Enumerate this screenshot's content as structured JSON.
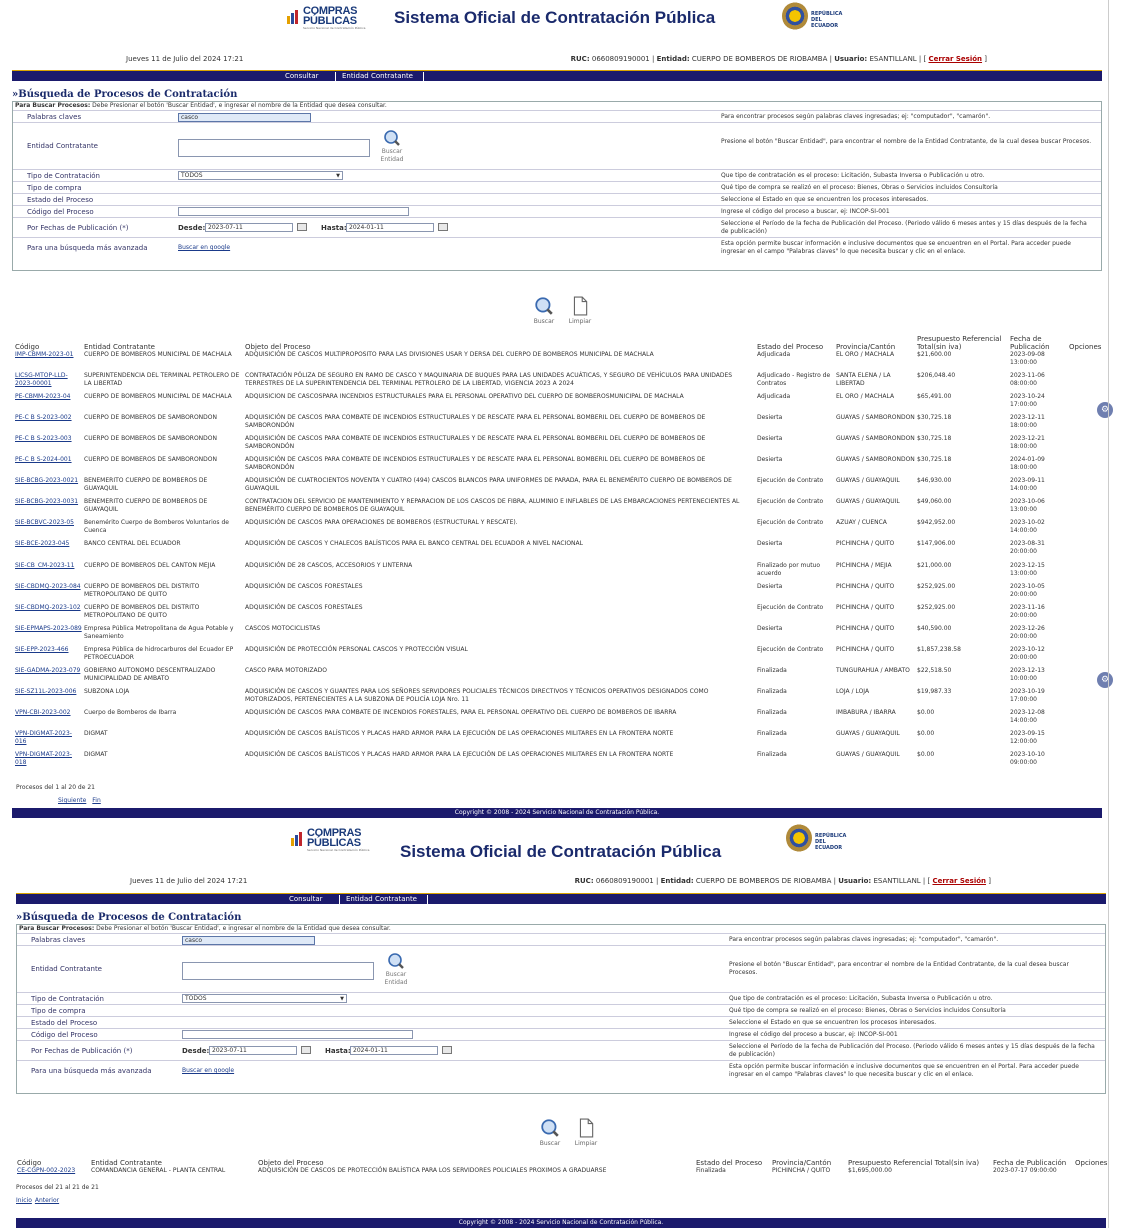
{
  "header": {
    "logo_line1": "COMPRAS",
    "logo_line2": "PÚBLICAS",
    "logo_sub": "Servicio Nacional de Contratación Pública",
    "system_title": "Sistema Oficial de Contratación Pública",
    "republic_line1": "REPÚBLICA",
    "republic_line2": "DEL ECUADOR"
  },
  "userbar": {
    "date": "Jueves 11 de Julio del 2024 17:21",
    "ruc_label": "RUC:",
    "ruc": "0660809190001",
    "entity_label": "Entidad:",
    "entity": "CUERPO DE BOMBEROS DE RIOBAMBA",
    "user_label": "Usuario:",
    "user": "ESANTILLANL",
    "logout": "Cerrar Sesión"
  },
  "nav": {
    "tab1": "Consultar",
    "tab2": "Entidad Contratante"
  },
  "search": {
    "title": "»Búsqueda de Procesos de Contratación",
    "instruction_bold": "Para Buscar Procesos:",
    "instruction": " Debe Presionar el botón 'Buscar Entidad', e ingresar el nombre de la Entidad que desea consultar.",
    "keywords_label": "Palabras claves",
    "keywords_value": "casco",
    "keywords_help": "Para encontrar procesos según palabras claves ingresadas; ej: \"computador\", \"camarón\".",
    "entity_label": "Entidad Contratante",
    "entity_button": "Buscar Entidad",
    "entity_help": "Presione el botón \"Buscar Entidad\", para encontrar el nombre de la Entidad Contratante, de la cual desea buscar Procesos.",
    "type_label": "Tipo de Contratación",
    "type_value": "TODOS",
    "type_help": "Que tipo de contratación es el proceso: Licitación, Subasta Inversa o Publicación u otro.",
    "purchase_label": "Tipo de compra",
    "purchase_help": "Qué tipo de compra se realizó en el proceso: Bienes, Obras o Servicios incluidos Consultoría",
    "state_label": "Estado del Proceso",
    "state_help": "Seleccione el Estado en que se encuentren los procesos interesados.",
    "code_label": "Código del Proceso",
    "code_help": "Ingrese el código del proceso a buscar, ej: INCOP-SI-001",
    "dates_label": "Por Fechas de Publicación (*)",
    "from_label": "Desde:",
    "from_value": "2023-07-11",
    "to_label": "Hasta:",
    "to_value": "2024-01-11",
    "dates_help": "Seleccione el Período de la fecha de Publicación del Proceso. (Periodo válido 6 meses antes y 15 días después de la fecha de publicación)",
    "advanced_label": "Para una búsqueda más avanzada",
    "advanced_link": "Buscar en google",
    "advanced_help": "Esta opción permite buscar información e inclusive documentos que se encuentren en el Portal. Para acceder puede ingresar en el campo \"Palabras claves\" lo que necesita buscar y clic en el enlace.",
    "btn_search": "Buscar",
    "btn_clear": "Limpiar"
  },
  "table": {
    "headers": [
      "Código",
      "Entidad Contratante",
      "Objeto del Proceso",
      "Estado del Proceso",
      "Provincia/Cantón",
      "Presupuesto Referencial Total(sin iva)",
      "Fecha de Publicación",
      "Opciones"
    ]
  },
  "rows1": [
    [
      "IMP-CBMM-2023-01",
      "CUERPO DE BOMBEROS MUNICIPAL DE MACHALA",
      "ADQUISICIÓN DE CASCOS MULTIPROPOSITO PARA LAS DIVISIONES USAR Y DERSA DEL CUERPO DE BOMBEROS MUNICIPAL DE MACHALA",
      "Adjudicada",
      "EL ORO / MACHALA",
      "$21,600.00",
      "2023-09-08 13:00:00"
    ],
    [
      "LICSG-MTOP-LLD-2023-00001",
      "SUPERINTENDENCIA DEL TERMINAL PETROLERO DE LA LIBERTAD",
      "CONTRATACIÓN PÓLIZA DE SEGURO EN RAMO DE CASCO Y MAQUINARIA DE BUQUES PARA LAS UNIDADES ACUÁTICAS, Y SEGURO DE VEHÍCULOS PARA UNIDADES TERRESTRES DE LA SUPERINTENDENCIA DEL TERMINAL PETROLERO DE LA LIBERTAD, VIGENCIA 2023 A 2024",
      "Adjudicado - Registro de Contratos",
      "SANTA ELENA / LA LIBERTAD",
      "$206,048.40",
      "2023-11-06 08:00:00"
    ],
    [
      "PE-CBMM-2023-04",
      "CUERPO DE BOMBEROS MUNICIPAL DE MACHALA",
      "ADQUISICION DE CASCOSPARA INCENDIOS ESTRUCTURALES PARA EL PERSONAL OPERATIVO DEL CUERPO DE BOMBEROSMUNICIPAL DE MACHALA",
      "Adjudicada",
      "EL ORO / MACHALA",
      "$65,491.00",
      "2023-10-24 17:00:00"
    ],
    [
      "PE-C B S-2023-002",
      "CUERPO DE BOMBEROS DE SAMBORONDON",
      "ADQUISICIÓN DE CASCOS PARA COMBATE DE INCENDIOS ESTRUCTURALES Y DE RESCATE PARA EL PERSONAL BOMBERIL DEL CUERPO DE BOMBEROS DE SAMBORONDÓN",
      "Desierta",
      "GUAYAS / SAMBORONDON",
      "$30,725.18",
      "2023-12-11 18:00:00"
    ],
    [
      "PE-C B S-2023-003",
      "CUERPO DE BOMBEROS DE SAMBORONDON",
      "ADQUISICIÓN DE CASCOS PARA COMBATE DE INCENDIOS ESTRUCTURALES Y DE RESCATE PARA EL PERSONAL BOMBERIL DEL CUERPO DE BOMBEROS DE SAMBORONDÓN",
      "Desierta",
      "GUAYAS / SAMBORONDON",
      "$30,725.18",
      "2023-12-21 18:00:00"
    ],
    [
      "PE-C B S-2024-001",
      "CUERPO DE BOMBEROS DE SAMBORONDON",
      "ADQUISICIÓN DE CASCOS PARA COMBATE DE INCENDIOS ESTRUCTURALES Y DE RESCATE PARA EL PERSONAL BOMBERIL DEL CUERPO DE BOMBEROS DE SAMBORONDÓN",
      "Desierta",
      "GUAYAS / SAMBORONDON",
      "$30,725.18",
      "2024-01-09 18:00:00"
    ],
    [
      "SIE-BCBG-2023-0021",
      "BENEMERITO CUERPO DE BOMBEROS DE GUAYAQUIL",
      "ADQUISICIÓN DE CUATROCIENTOS NOVENTA Y CUATRO (494) CASCOS BLANCOS PARA UNIFORMES DE PARADA, PARA EL BENEMÉRITO CUERPO DE BOMBEROS DE GUAYAQUIL",
      "Ejecución de Contrato",
      "GUAYAS / GUAYAQUIL",
      "$46,930.00",
      "2023-09-11 14:00:00"
    ],
    [
      "SIE-BCBG-2023-0031",
      "BENEMERITO CUERPO DE BOMBEROS DE GUAYAQUIL",
      "CONTRATACION DEL SERVICIO DE MANTENIMIENTO Y REPARACION DE LOS CASCOS DE FIBRA, ALUMINIO E INFLABLES DE LAS EMBARCACIONES PERTENECIENTES AL BENEMÉRITO CUERPO DE BOMBEROS DE GUAYAQUIL",
      "Ejecución de Contrato",
      "GUAYAS / GUAYAQUIL",
      "$49,060.00",
      "2023-10-06 13:00:00"
    ],
    [
      "SIE-BCBVC-2023-05",
      "Benemérito Cuerpo de Bomberos Voluntarios de Cuenca",
      "ADQUISICIÓN DE CASCOS PARA OPERACIONES DE BOMBEROS (ESTRUCTURAL Y RESCATE).",
      "Ejecución de Contrato",
      "AZUAY / CUENCA",
      "$942,952.00",
      "2023-10-02 14:00:00"
    ],
    [
      "SIE-BCE-2023-045",
      "BANCO CENTRAL DEL ECUADOR",
      "ADQUISICIÓN DE CASCOS Y CHALECOS BALÍSTICOS PARA EL BANCO CENTRAL DEL ECUADOR A NIVEL NACIONAL",
      "Desierta",
      "PICHINCHA / QUITO",
      "$147,906.00",
      "2023-08-31 20:00:00"
    ],
    [
      "SIE-CB_CM-2023-11",
      "CUERPO DE BOMBEROS DEL CANTON MEJIA",
      "ADQUISICIÓN DE 28 CASCOS, ACCESORIOS Y LINTERNA",
      "Finalizado por mutuo acuerdo",
      "PICHINCHA / MEJIA",
      "$21,000.00",
      "2023-12-15 13:00:00"
    ],
    [
      "SIE-CBDMQ-2023-084",
      "CUERPO DE BOMBEROS DEL DISTRITO METROPOLITANO DE QUITO",
      "ADQUISICIÓN DE CASCOS FORESTALES",
      "Desierta",
      "PICHINCHA / QUITO",
      "$252,925.00",
      "2023-10-05 20:00:00"
    ],
    [
      "SIE-CBDMQ-2023-102",
      "CUERPO DE BOMBEROS DEL DISTRITO METROPOLITANO DE QUITO",
      "ADQUISICIÓN DE CASCOS FORESTALES",
      "Ejecución de Contrato",
      "PICHINCHA / QUITO",
      "$252,925.00",
      "2023-11-16 20:00:00"
    ],
    [
      "SIE-EPMAPS-2023-089",
      "Empresa Pública Metropolitana de Agua Potable y Saneamiento",
      "CASCOS MOTOCICLISTAS",
      "Desierta",
      "PICHINCHA / QUITO",
      "$40,590.00",
      "2023-12-26 20:00:00"
    ],
    [
      "SIE-EPP-2023-466",
      "Empresa Pública de hidrocarburos del Ecuador EP PETROECUADOR",
      "ADQUISICIÓN DE PROTECCIÓN PERSONAL CASCOS Y PROTECCIÓN VISUAL",
      "Ejecución de Contrato",
      "PICHINCHA / QUITO",
      "$1,857,238.58",
      "2023-10-12 20:00:00"
    ],
    [
      "SIE-GADMA-2023-079",
      "GOBIERNO AUTONOMO DESCENTRALIZADO MUNICIPALIDAD DE AMBATO",
      "CASCO PARA MOTORIZADO",
      "Finalizada",
      "TUNGURAHUA / AMBATO",
      "$22,518.50",
      "2023-12-13 10:00:00"
    ],
    [
      "SIE-SZ11L-2023-006",
      "SUBZONA LOJA",
      "ADQUISICIÓN DE CASCOS Y GUANTES PARA LOS SEÑORES SERVIDORES POLICIALES TÉCNICOS DIRECTIVOS Y TÉCNICOS OPERATIVOS DESIGNADOS COMO MOTORIZADOS, PERTENECIENTES A LA SUBZONA DE POLICÍA LOJA Nro. 11",
      "Finalizada",
      "LOJA / LOJA",
      "$19,987.33",
      "2023-10-19 17:00:00"
    ],
    [
      "VPN-CBI-2023-002",
      "Cuerpo de Bomberos de Ibarra",
      "ADQUISICIÓN DE CASCOS PARA COMBATE DE INCENDIOS FORESTALES, PARA EL PERSONAL OPERATIVO DEL CUERPO DE BOMBEROS DE IBARRA",
      "Finalizada",
      "IMBABURA / IBARRA",
      "$0.00",
      "2023-12-08 14:00:00"
    ],
    [
      "VPN-DIGMAT-2023-016",
      "DIGMAT",
      "ADQUISICIÓN DE CASCOS BALÍSTICOS Y PLACAS HARD ARMOR PARA LA EJECUCIÓN DE LAS OPERACIONES MILITARES EN LA FRONTERA NORTE",
      "Finalizada",
      "GUAYAS / GUAYAQUIL",
      "$0.00",
      "2023-09-15 12:00:00"
    ],
    [
      "VPN-DIGMAT-2023-018",
      "DIGMAT",
      "ADQUISICIÓN DE CASCOS BALÍSTICOS Y PLACAS HARD ARMOR PARA LA EJECUCIÓN DE LAS OPERACIONES MILITARES EN LA FRONTERA NORTE",
      "Finalizada",
      "GUAYAS / GUAYAQUIL",
      "$0.00",
      "2023-10-10 09:00:00"
    ]
  ],
  "paging1": {
    "info": "Procesos del 1 al 20 de 21",
    "next": "Siguiente",
    "end": "Fin"
  },
  "rows2": [
    [
      "CE-CGPN-002-2023",
      "COMANDANCIA GENERAL - PLANTA CENTRAL",
      "ADQUISICIÓN DE CASCOS DE PROTECCIÓN BALÍSTICA PARA LOS SERVIDORES POLICIALES PROXIMOS A GRADUARSE",
      "Finalizada",
      "PICHINCHA / QUITO",
      "$1,695,000.00",
      "2023-07-17 09:00:00"
    ]
  ],
  "paging2": {
    "info": "Procesos del 21 al 21 de 21",
    "start": "Inicio",
    "prev": "Anterior"
  },
  "footer": "Copyright © 2008 - 2024 Servicio Nacional de Contratación Pública."
}
